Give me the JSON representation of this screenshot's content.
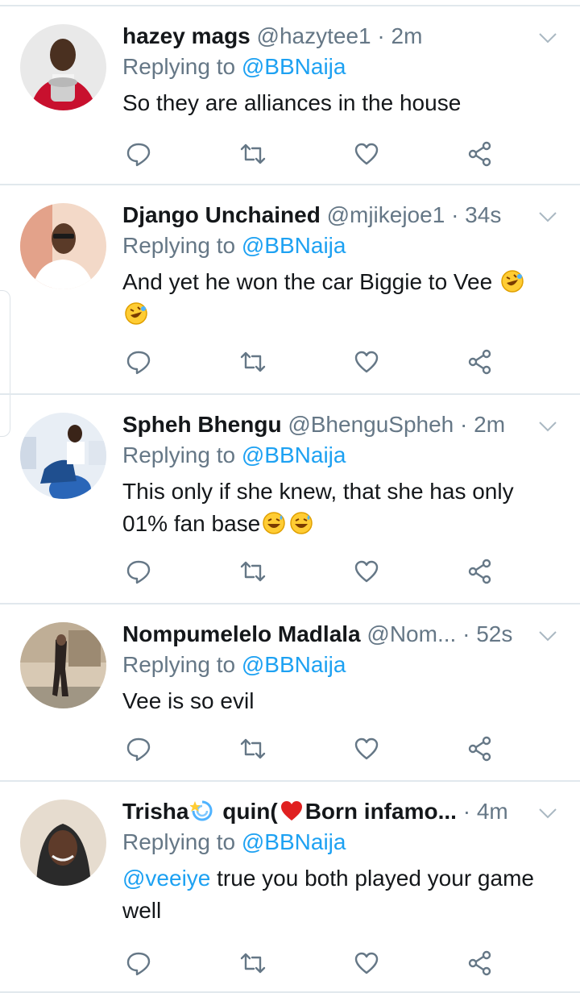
{
  "replying_label": "Replying to",
  "tweets": [
    {
      "name": "hazey mags",
      "handle": "@hazytee1",
      "dot": "·",
      "time": "2m",
      "reply_to": "@BBNaija",
      "text": "So they are alliances in the house",
      "avatar_colors": [
        "#c8102e",
        "#f4f4f4"
      ]
    },
    {
      "name": "Django Unchained",
      "handle": "@mjikejoe1",
      "dot": "·",
      "time": "34s",
      "reply_to": "@BBNaija",
      "text": "And yet he won the car Biggie to Vee",
      "emojis": [
        "rofl",
        "rofl"
      ],
      "avatar_colors": [
        "#d9534f",
        "#ffffff"
      ]
    },
    {
      "name": "Spheh Bhengu",
      "handle": "@BhenguSpheh",
      "dot": "·",
      "time": "2m",
      "reply_to": "@BBNaija",
      "text_line1": "This only if she knew, that she has only",
      "text_line2": "01% fan base",
      "emojis": [
        "sweat-smile",
        "sweat-smile"
      ],
      "avatar_colors": [
        "#2a66b8",
        "#e8eef5"
      ]
    },
    {
      "name": "Nompumelelo Madlala",
      "handle": "@Nom...",
      "dot": "·",
      "time": "52s",
      "reply_to": "@BBNaija",
      "text": "Vee is so evil",
      "avatar_colors": [
        "#6b4e3d",
        "#d8c9b4"
      ]
    },
    {
      "name_part1": "Trisha",
      "name_part2": "quin(",
      "name_part3": "Born infamo...",
      "dot": "·",
      "time": "4m",
      "reply_to": "@BBNaija",
      "text_mention": "@veeiye",
      "text_rest": " true you both played your game",
      "text_line2": "well",
      "emojis": [
        "dizzy",
        "red-heart"
      ],
      "avatar_colors": [
        "#3b3b3b",
        "#d9c9b8"
      ]
    }
  ],
  "icons": {
    "reply": "reply-icon",
    "retweet": "retweet-icon",
    "like": "like-icon",
    "share": "share-icon",
    "caret": "chevron-down-icon"
  },
  "colors": {
    "text": "#14171a",
    "muted": "#657786",
    "link": "#1da1f2",
    "divider": "#e1e8ed"
  }
}
